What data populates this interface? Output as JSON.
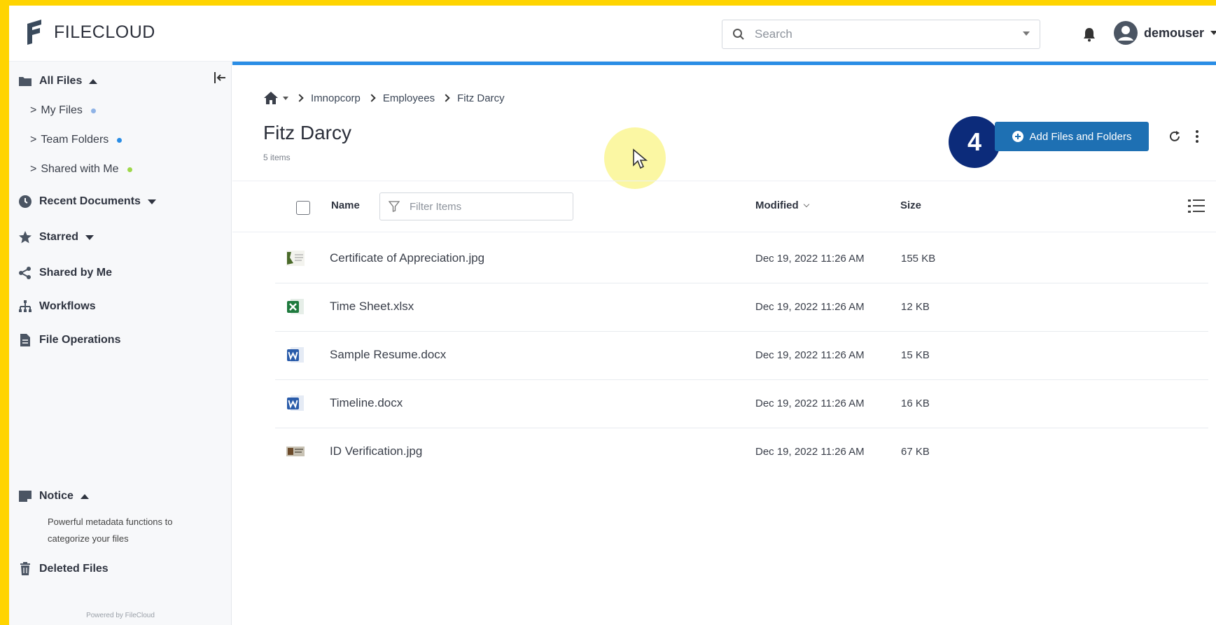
{
  "colors": {
    "frame": "#FFD400",
    "accent": "#1e70b3",
    "progress": "#2a8de5",
    "badge": "#0c2b7a"
  },
  "header": {
    "logo_text_bold": "FILE",
    "logo_text_light": "CLOUD",
    "search_placeholder": "Search",
    "username": "demouser"
  },
  "sidebar": {
    "all_files": "All Files",
    "sub_items": [
      {
        "label": "My Files",
        "dot": "#8fb3e6"
      },
      {
        "label": "Team Folders",
        "dot": "#2a8de5"
      },
      {
        "label": "Shared with Me",
        "dot": "#9ed84a"
      }
    ],
    "recent_documents": "Recent Documents",
    "starred": "Starred",
    "shared_by_me": "Shared by Me",
    "workflows": "Workflows",
    "file_operations": "File Operations",
    "notice": "Notice",
    "notice_text": "Powerful metadata functions to categorize your files",
    "deleted_files": "Deleted Files",
    "powered_by": "Powered by FileCloud"
  },
  "main": {
    "breadcrumb": [
      "Imnopcorp",
      "Employees",
      "Fitz Darcy"
    ],
    "title": "Fitz Darcy",
    "item_count": "5 items",
    "step_badge": "4",
    "add_button": "Add Files and Folders",
    "columns": {
      "name": "Name",
      "filter_placeholder": "Filter Items",
      "modified": "Modified",
      "size": "Size"
    },
    "files": [
      {
        "name": "Certificate of Appreciation.jpg",
        "modified": "Dec 19, 2022 11:26 AM",
        "size": "155 KB",
        "type": "image-cert"
      },
      {
        "name": "Time Sheet.xlsx",
        "modified": "Dec 19, 2022 11:26 AM",
        "size": "12 KB",
        "type": "excel"
      },
      {
        "name": "Sample Resume.docx",
        "modified": "Dec 19, 2022 11:26 AM",
        "size": "15 KB",
        "type": "word"
      },
      {
        "name": "Timeline.docx",
        "modified": "Dec 19, 2022 11:26 AM",
        "size": "16 KB",
        "type": "word"
      },
      {
        "name": "ID Verification.jpg",
        "modified": "Dec 19, 2022 11:26 AM",
        "size": "67 KB",
        "type": "image-id"
      }
    ]
  }
}
